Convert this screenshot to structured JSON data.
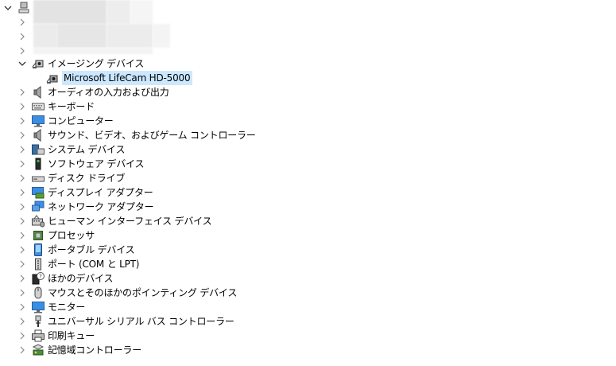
{
  "tree": {
    "categories": [
      {
        "label": "イメージング デバイス",
        "icon": "camera-icon",
        "expanded": true
      },
      {
        "label": "オーディオの入力および出力",
        "icon": "speaker-icon"
      },
      {
        "label": "キーボード",
        "icon": "keyboard-icon"
      },
      {
        "label": "コンピューター",
        "icon": "computer-icon"
      },
      {
        "label": "サウンド、ビデオ、およびゲーム コントローラー",
        "icon": "speaker-icon"
      },
      {
        "label": "システム デバイス",
        "icon": "system-devices-icon"
      },
      {
        "label": "ソフトウェア デバイス",
        "icon": "software-device-icon"
      },
      {
        "label": "ディスク ドライブ",
        "icon": "disk-drive-icon"
      },
      {
        "label": "ディスプレイ アダプター",
        "icon": "display-adapter-icon"
      },
      {
        "label": "ネットワーク アダプター",
        "icon": "network-adapter-icon"
      },
      {
        "label": "ヒューマン インターフェイス デバイス",
        "icon": "hid-icon"
      },
      {
        "label": "プロセッサ",
        "icon": "processor-icon"
      },
      {
        "label": "ポータブル デバイス",
        "icon": "portable-device-icon"
      },
      {
        "label": "ポート (COM と LPT)",
        "icon": "port-icon"
      },
      {
        "label": "ほかのデバイス",
        "icon": "unknown-device-icon"
      },
      {
        "label": "マウスとそのほかのポインティング デバイス",
        "icon": "mouse-icon"
      },
      {
        "label": "モニター",
        "icon": "monitor-icon"
      },
      {
        "label": "ユニバーサル シリアル バス コントローラー",
        "icon": "usb-icon"
      },
      {
        "label": "印刷キュー",
        "icon": "printer-icon"
      },
      {
        "label": "記憶域コントローラー",
        "icon": "storage-controller-icon"
      }
    ],
    "imaging_children": [
      {
        "label": "Microsoft LifeCam HD-5000",
        "icon": "webcam-icon",
        "selected": true
      }
    ]
  }
}
